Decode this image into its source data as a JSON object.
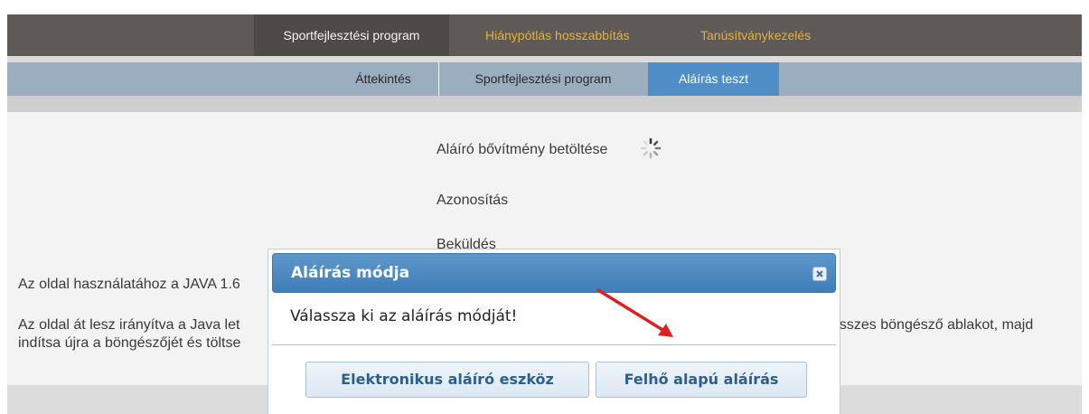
{
  "topnav": {
    "items": [
      {
        "label": "Sportfejlesztési program"
      },
      {
        "label": "Hiánypótlás hosszabbítás"
      },
      {
        "label": "Tanúsítványkezelés"
      }
    ]
  },
  "subnav": {
    "items": [
      {
        "label": "Áttekintés"
      },
      {
        "label": "Sportfejlesztési program"
      },
      {
        "label": "Aláírás teszt"
      }
    ]
  },
  "steps": {
    "loading": "Aláíró bővítmény betöltése",
    "auth": "Azonosítás",
    "send": "Beküldés"
  },
  "notice": {
    "java_prefix": "Az oldal használatához a JAVA 1.6",
    "redirect_line1": "Az oldal át lesz irányítva a Java let",
    "redirect_line1_right": "összes böngésző ablakot, majd",
    "redirect_line2": "indítsa újra a böngészőjét és töltse"
  },
  "dialog": {
    "title": "Aláírás módja",
    "message": "Válassza ki az aláírás módját!",
    "button_device": "Elektronikus aláíró eszköz",
    "button_cloud": "Felhő alapú aláírás"
  },
  "colors": {
    "topnav_bg": "#5f5a57",
    "topnav_gold": "#e6b331",
    "subnav_bg": "#9aaec0",
    "subnav_active": "#4f8ec7",
    "dialog_title": "#3f7eba",
    "button_text": "#2d5f8c",
    "annotation_arrow": "#e02020"
  }
}
